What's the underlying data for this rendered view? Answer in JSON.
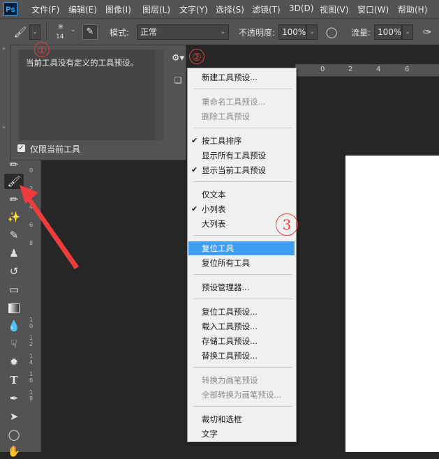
{
  "app": {
    "logo": "Ps"
  },
  "menubar": [
    "文件(F)",
    "编辑(E)",
    "图像(I)",
    "图层(L)",
    "文字(Y)",
    "选择(S)",
    "滤镜(T)",
    "3D(D)",
    "视图(V)",
    "窗口(W)",
    "帮助(H)"
  ],
  "options": {
    "brush_size": "14",
    "mode_label": "模式:",
    "mode_value": "正常",
    "opacity_label": "不透明度:",
    "opacity_value": "100%",
    "flow_label": "流量:",
    "flow_value": "100%"
  },
  "preset_panel": {
    "empty_message": "当前工具没有定义的工具预设。",
    "current_tool_only_label": "仅限当前工具",
    "current_tool_only_checked": true
  },
  "context_menu": {
    "groups": [
      [
        {
          "label": "新建工具预设...",
          "disabled": false,
          "checked": false
        }
      ],
      [
        {
          "label": "重命名工具预设...",
          "disabled": true,
          "checked": false
        },
        {
          "label": "删除工具预设",
          "disabled": true,
          "checked": false
        }
      ],
      [
        {
          "label": "按工具排序",
          "disabled": false,
          "checked": true
        },
        {
          "label": "显示所有工具预设",
          "disabled": false,
          "checked": false
        },
        {
          "label": "显示当前工具预设",
          "disabled": false,
          "checked": true
        }
      ],
      [
        {
          "label": "仅文本",
          "disabled": false,
          "checked": false
        },
        {
          "label": "小列表",
          "disabled": false,
          "checked": true
        },
        {
          "label": "大列表",
          "disabled": false,
          "checked": false
        }
      ],
      [
        {
          "label": "复位工具",
          "disabled": false,
          "checked": false,
          "highlighted": true
        },
        {
          "label": "复位所有工具",
          "disabled": false,
          "checked": false
        }
      ],
      [
        {
          "label": "预设管理器...",
          "disabled": false,
          "checked": false
        }
      ],
      [
        {
          "label": "复位工具预设...",
          "disabled": false,
          "checked": false
        },
        {
          "label": "载入工具预设...",
          "disabled": false,
          "checked": false
        },
        {
          "label": "存储工具预设...",
          "disabled": false,
          "checked": false
        },
        {
          "label": "替换工具预设...",
          "disabled": false,
          "checked": false
        }
      ],
      [
        {
          "label": "转换为画笔预设",
          "disabled": true,
          "checked": false
        },
        {
          "label": "全部转换为画笔预设...",
          "disabled": true,
          "checked": false
        }
      ],
      [
        {
          "label": "裁切和选框",
          "disabled": false,
          "checked": false
        },
        {
          "label": "文字",
          "disabled": false,
          "checked": false
        }
      ]
    ]
  },
  "annotations": {
    "one": "①",
    "two": "②",
    "three": "3"
  },
  "ruler": {
    "horizontal": [
      "0",
      "2",
      "4",
      "6"
    ],
    "vertical": [
      "0",
      "2",
      "4",
      "6",
      "8",
      "1\n0",
      "1\n2",
      "1\n4",
      "1\n6",
      "1\n8"
    ]
  },
  "colors": {
    "accent": "#3f9df2",
    "annotation": "#e84040"
  }
}
